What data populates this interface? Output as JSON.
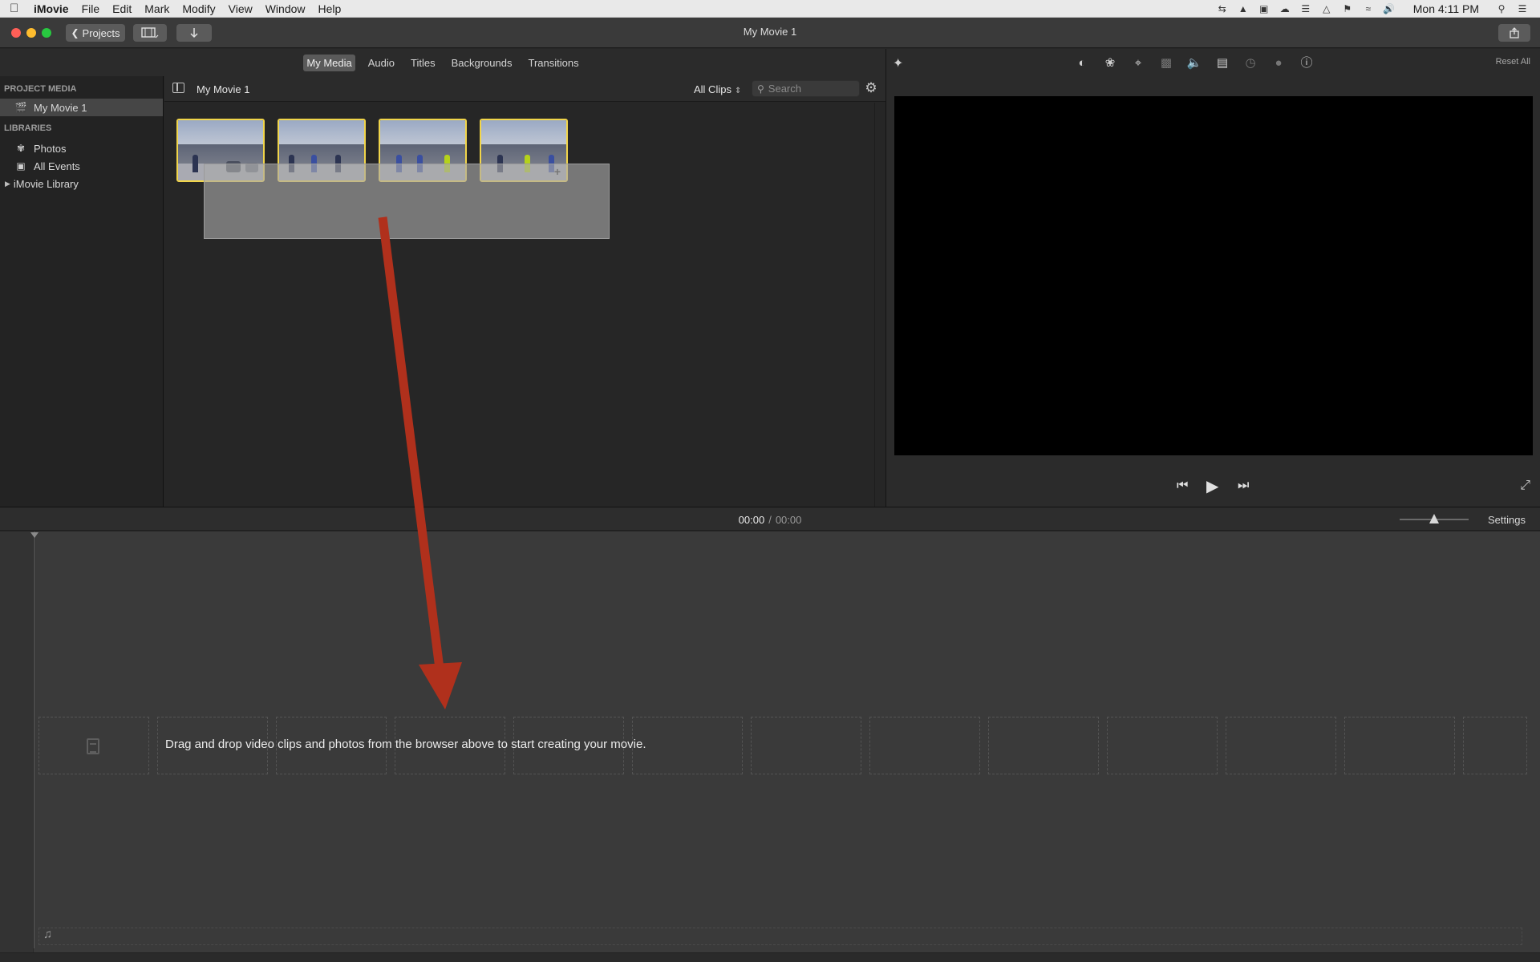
{
  "menubar": {
    "app": "iMovie",
    "items": [
      "File",
      "Edit",
      "Mark",
      "Modify",
      "View",
      "Window",
      "Help"
    ],
    "clock": "Mon 4:11 PM"
  },
  "toolbar": {
    "projects_label": "Projects",
    "window_title": "My Movie 1"
  },
  "tabs": [
    "My Media",
    "Audio",
    "Titles",
    "Backgrounds",
    "Transitions"
  ],
  "sidebar": {
    "project_media_header": "PROJECT MEDIA",
    "project_item": "My Movie 1",
    "libraries_header": "LIBRARIES",
    "library_items": [
      "Photos",
      "All Events"
    ],
    "library_root": "iMovie Library"
  },
  "browser": {
    "title": "My Movie 1",
    "filter": "All Clips",
    "search_placeholder": "Search"
  },
  "viewer": {
    "reset_all": "Reset All"
  },
  "timeline": {
    "current_time": "00:00",
    "separator": "/",
    "total_time": "00:00",
    "settings_label": "Settings",
    "drop_message": "Drag and drop video clips and photos from the browser above to start creating your movie."
  },
  "colors": {
    "selection": "#f1d54a",
    "arrow": "#b0301c"
  }
}
